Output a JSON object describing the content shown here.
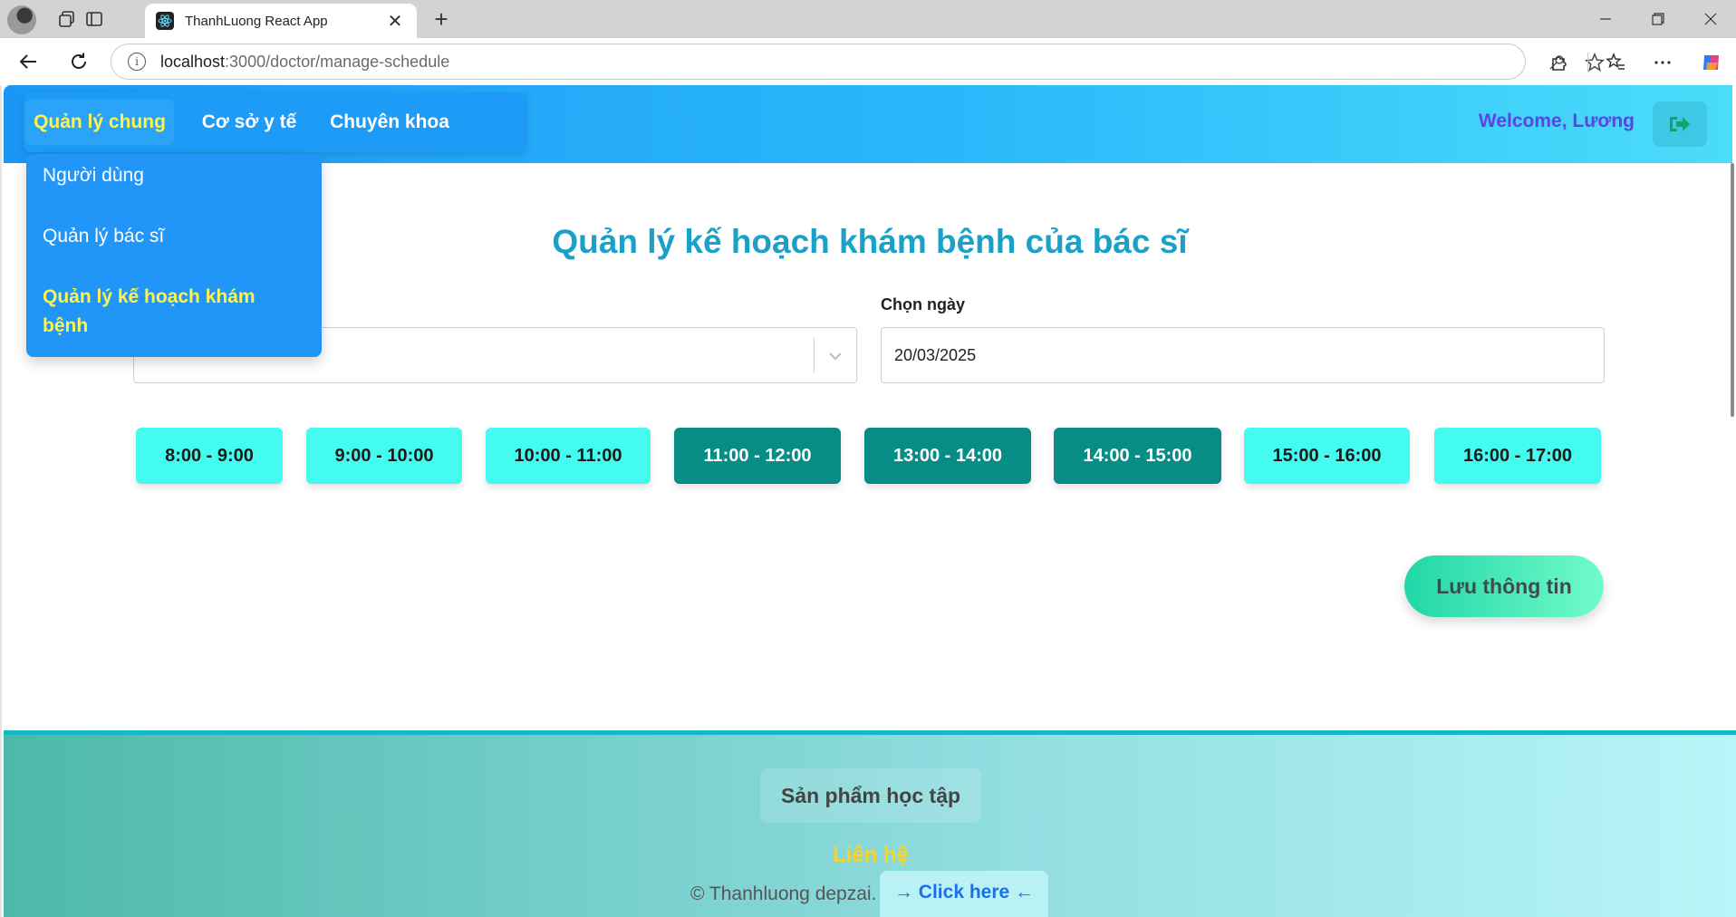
{
  "browser": {
    "tab_title": "ThanhLuong React App",
    "url_host": "localhost",
    "url_path": ":3000/doctor/manage-schedule"
  },
  "header": {
    "menu": [
      {
        "label": "Quản lý chung",
        "active": true
      },
      {
        "label": "Cơ sở y tế",
        "active": false
      },
      {
        "label": "Chuyên khoa",
        "active": false
      }
    ],
    "welcome": "Welcome, Lương"
  },
  "dropdown": {
    "items": [
      {
        "label": "Người dùng",
        "active": false
      },
      {
        "label": "Quản lý bác sĩ",
        "active": false
      },
      {
        "label": "Quản lý kế hoạch khám bệnh",
        "active": true
      }
    ]
  },
  "main": {
    "title": "Quản lý kế hoạch khám bệnh của bác sĩ",
    "date_label": "Chọn ngày",
    "date_value": "20/03/2025",
    "slots": [
      {
        "label": "8:00 - 9:00",
        "selected": false
      },
      {
        "label": "9:00 - 10:00",
        "selected": false
      },
      {
        "label": "10:00 - 11:00",
        "selected": false
      },
      {
        "label": "11:00 - 12:00",
        "selected": true
      },
      {
        "label": "13:00 - 14:00",
        "selected": true
      },
      {
        "label": "14:00 - 15:00",
        "selected": true
      },
      {
        "label": "15:00 - 16:00",
        "selected": false
      },
      {
        "label": "16:00 - 17:00",
        "selected": false
      }
    ],
    "save_label": "Lưu thông tin"
  },
  "footer": {
    "product": "Sản phẩm học tập",
    "contact": "Liên hệ",
    "copyright": "© Thanhluong depzai.",
    "link": "→ Click here ←"
  },
  "colors": {
    "header_start": "#1a97f5",
    "header_end": "#4bdcfa",
    "active_menu_text": "#fff44d",
    "title": "#1ba1c8",
    "slot_off": "#43fbee",
    "slot_on": "#088c86"
  }
}
